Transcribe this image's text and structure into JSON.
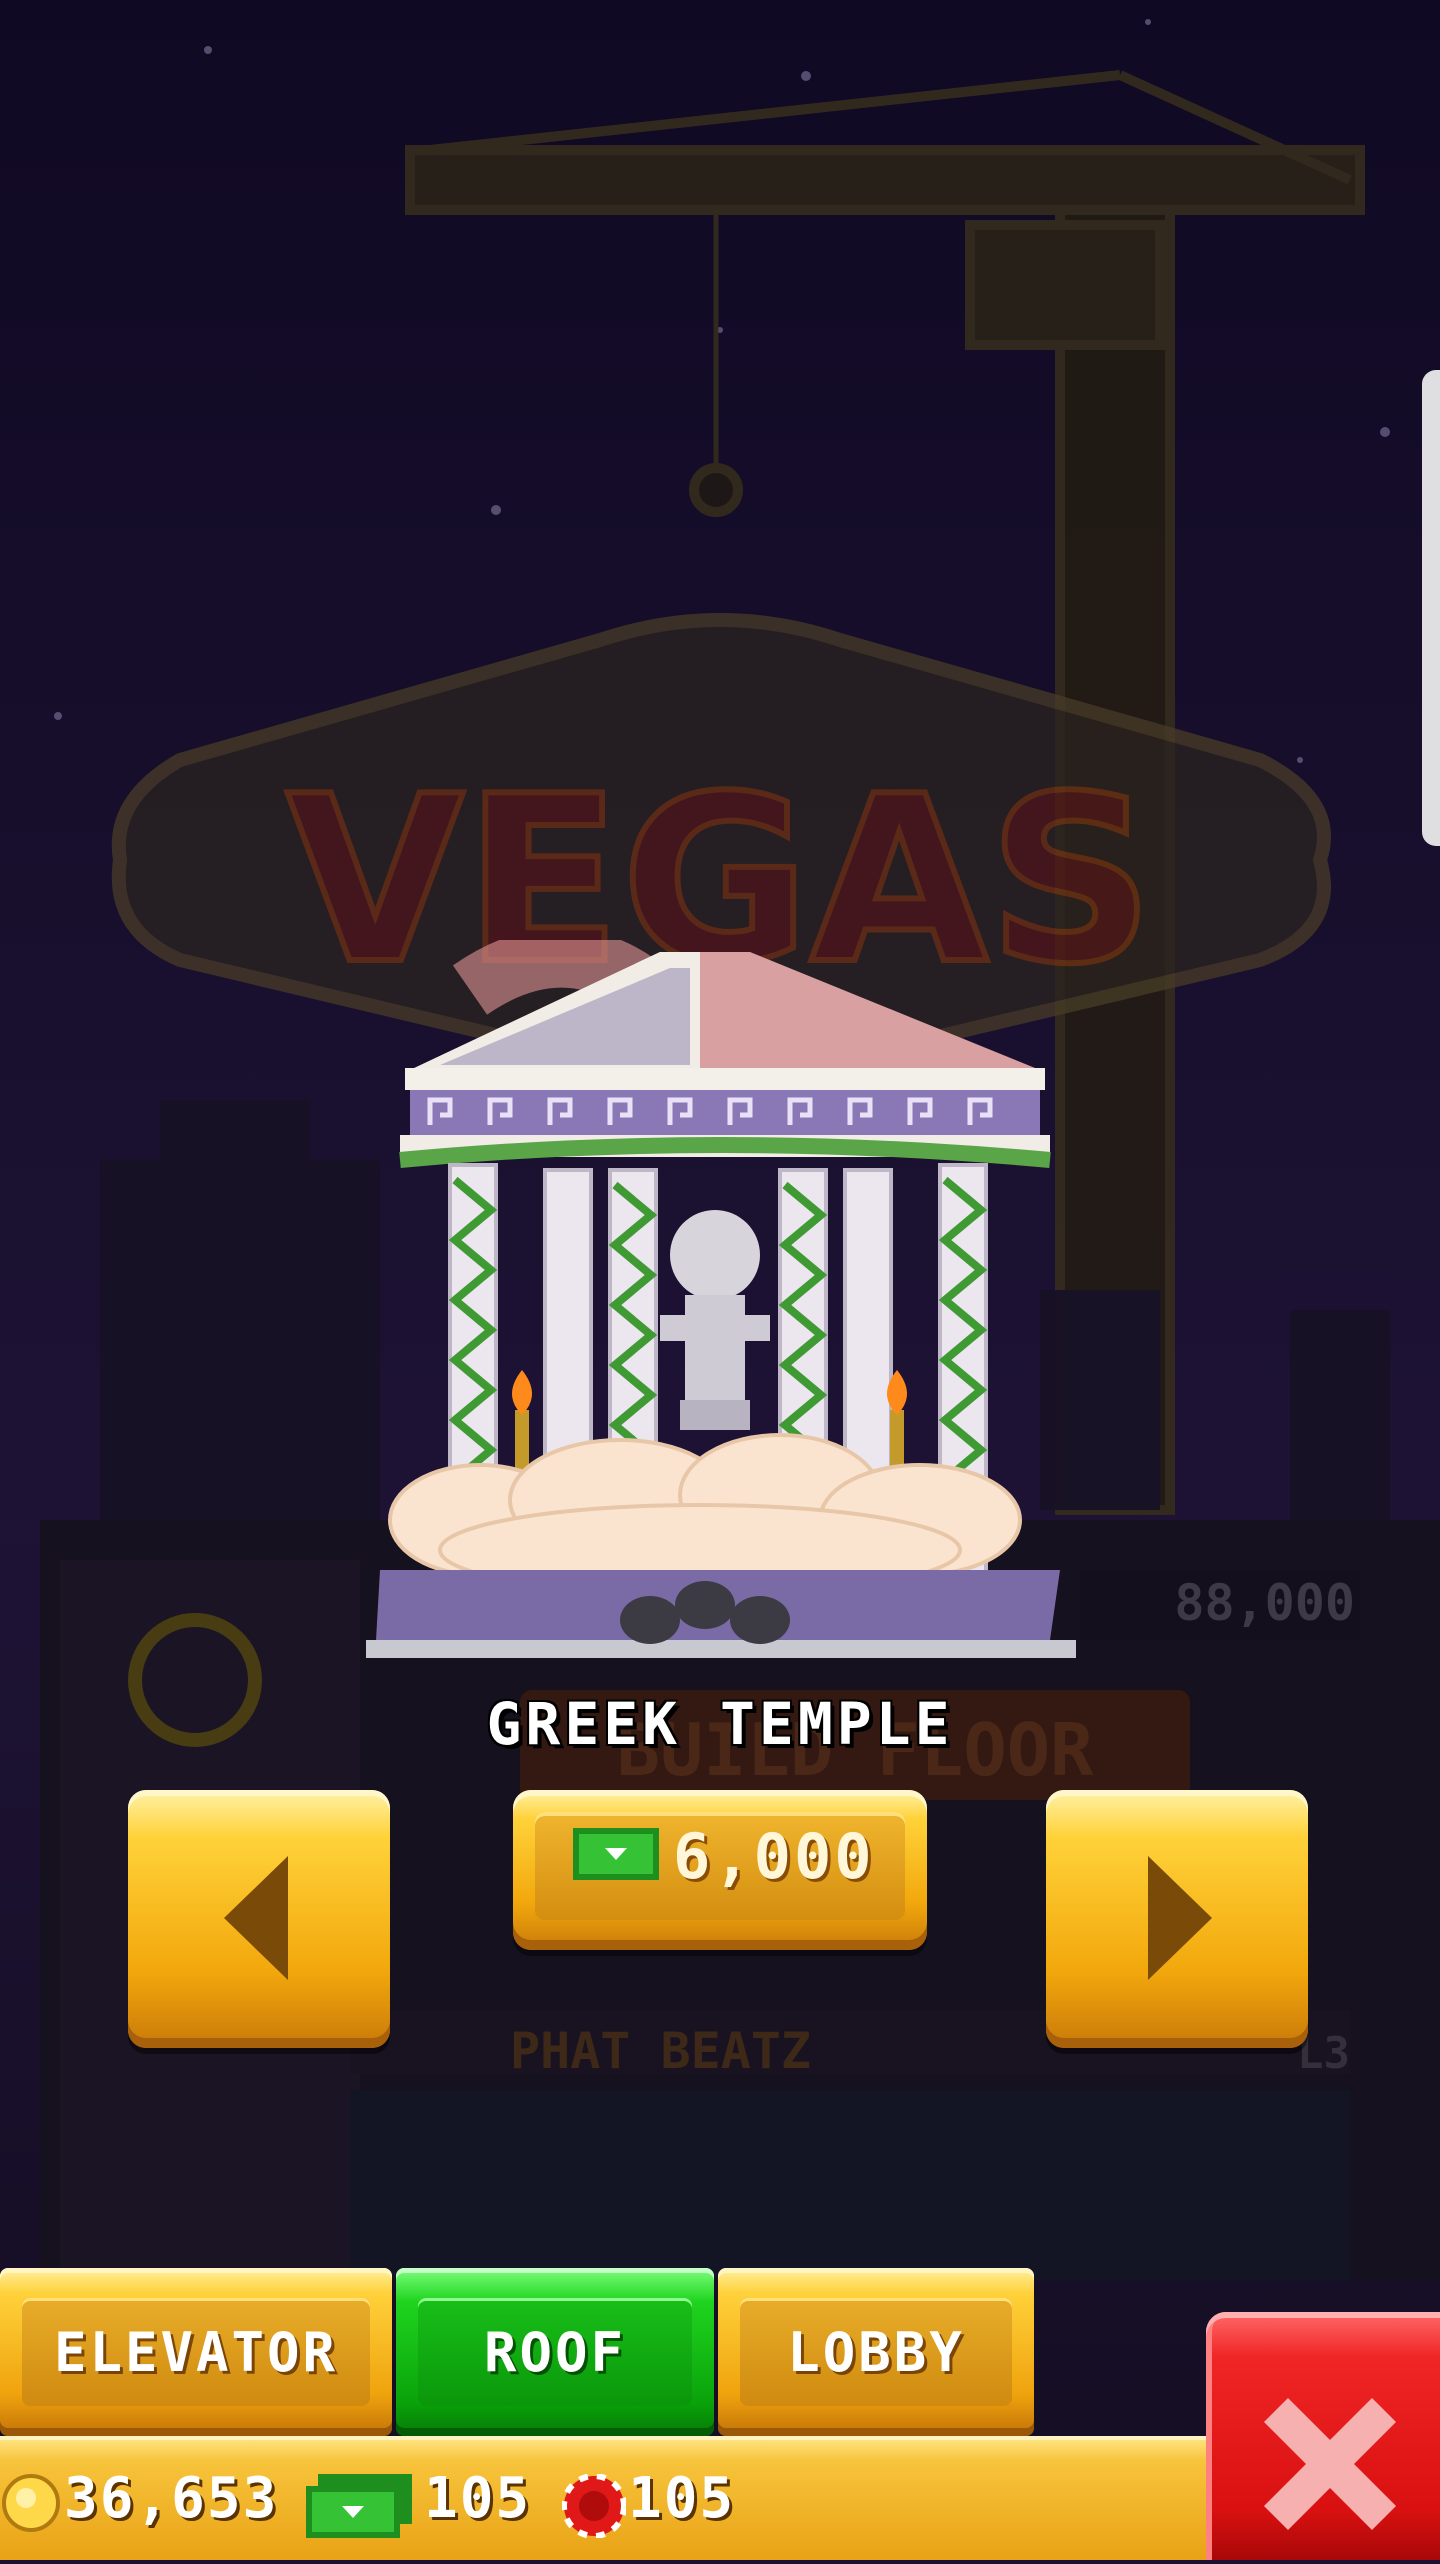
{
  "item": {
    "name": "GREEK TEMPLE",
    "price": "6,000"
  },
  "background": {
    "sign_text": "VEGAS",
    "floor_price": "88,000",
    "floor_name": "PHAT BEATZ",
    "floor_level": "L3",
    "build_label": "BUILD FLOOR"
  },
  "tabs": [
    {
      "label": "ELEVATOR",
      "active": false
    },
    {
      "label": "ROOF",
      "active": true
    },
    {
      "label": "LOBBY",
      "active": false
    }
  ],
  "currency": {
    "coins": "36,653",
    "bux": "105",
    "chips": "105"
  },
  "colors": {
    "gold": "#f2a80c",
    "active_tab": "#1fd41f",
    "close": "#e01818",
    "night_sky": "#1c1233"
  },
  "icons": {
    "prev": "arrow-left-icon",
    "next": "arrow-right-icon",
    "price": "tower-bux-icon",
    "coin": "coin-icon",
    "chip": "casino-chip-icon",
    "close": "close-x-icon"
  }
}
